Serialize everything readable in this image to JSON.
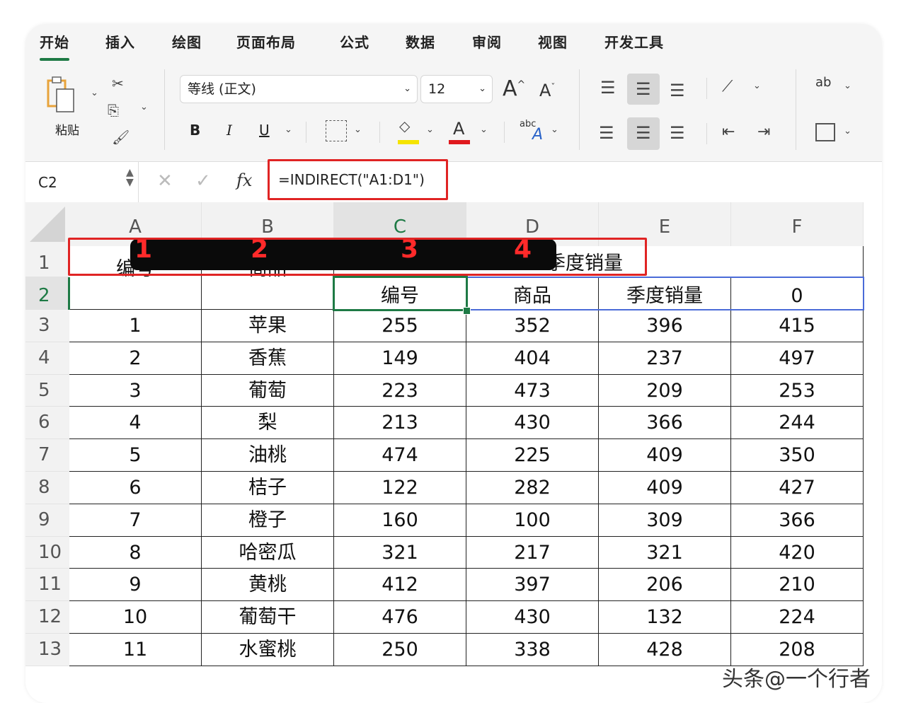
{
  "tabs": [
    "开始",
    "插入",
    "绘图",
    "页面布局",
    "公式",
    "数据",
    "审阅",
    "视图",
    "开发工具"
  ],
  "ribbon": {
    "paste_label": "粘贴",
    "font_name": "等线 (正文)",
    "font_size": "12",
    "bold": "B",
    "italic": "I",
    "underline": "U",
    "grow_font": "A",
    "shrink_font": "A",
    "abc": "abc",
    "wrap": "ab"
  },
  "formula_bar": {
    "name_box": "C2",
    "fx": "fx",
    "formula": "=INDIRECT(\"A1:D1\")"
  },
  "columns": [
    "A",
    "B",
    "C",
    "D",
    "E",
    "F"
  ],
  "annotation_numbers": [
    "1",
    "2",
    "3",
    "4"
  ],
  "row1": {
    "e_text": "季度销量"
  },
  "header": {
    "a": "编号",
    "b": "商品",
    "c": "编号",
    "d": "商品",
    "e": "季度销量",
    "f": "0"
  },
  "rows": [
    {
      "n": "3",
      "a": "1",
      "b": "苹果",
      "c": "255",
      "d": "352",
      "e": "396",
      "f": "415"
    },
    {
      "n": "4",
      "a": "2",
      "b": "香蕉",
      "c": "149",
      "d": "404",
      "e": "237",
      "f": "497"
    },
    {
      "n": "5",
      "a": "3",
      "b": "葡萄",
      "c": "223",
      "d": "473",
      "e": "209",
      "f": "253"
    },
    {
      "n": "6",
      "a": "4",
      "b": "梨",
      "c": "213",
      "d": "430",
      "e": "366",
      "f": "244"
    },
    {
      "n": "7",
      "a": "5",
      "b": "油桃",
      "c": "474",
      "d": "225",
      "e": "409",
      "f": "350"
    },
    {
      "n": "8",
      "a": "6",
      "b": "桔子",
      "c": "122",
      "d": "282",
      "e": "409",
      "f": "427"
    },
    {
      "n": "9",
      "a": "7",
      "b": "橙子",
      "c": "160",
      "d": "100",
      "e": "309",
      "f": "366"
    },
    {
      "n": "10",
      "a": "8",
      "b": "哈密瓜",
      "c": "321",
      "d": "217",
      "e": "321",
      "f": "420"
    },
    {
      "n": "11",
      "a": "9",
      "b": "黄桃",
      "c": "412",
      "d": "397",
      "e": "206",
      "f": "210"
    },
    {
      "n": "12",
      "a": "10",
      "b": "葡萄干",
      "c": "476",
      "d": "430",
      "e": "132",
      "f": "224"
    },
    {
      "n": "13",
      "a": "11",
      "b": "水蜜桃",
      "c": "250",
      "d": "338",
      "e": "428",
      "f": "208"
    }
  ],
  "row_numbers": [
    "1",
    "2"
  ],
  "watermark": "头条@一个行者"
}
